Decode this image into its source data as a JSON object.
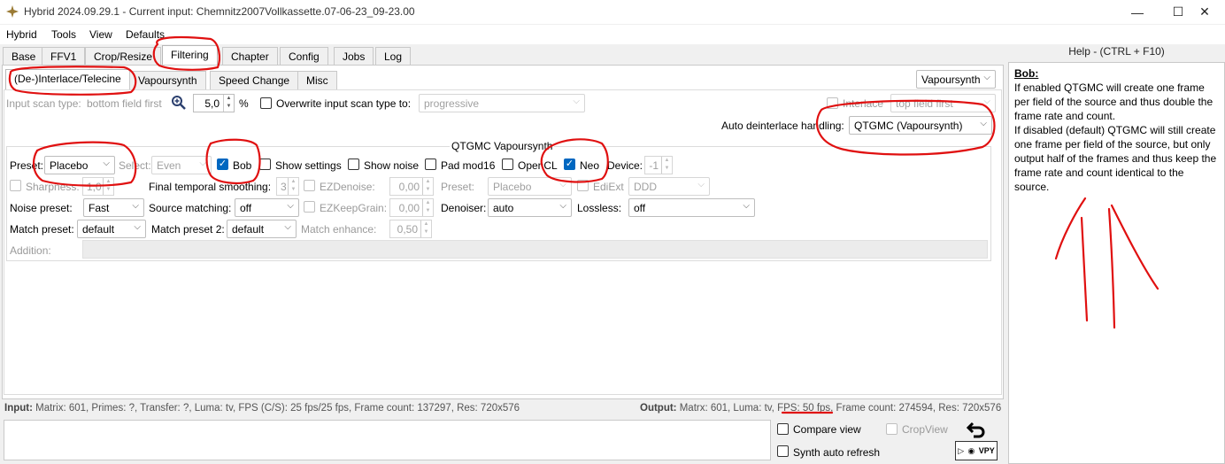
{
  "window": {
    "title": "Hybrid 2024.09.29.1 - Current input: Chemnitz2007Vollkassette.07-06-23_09-23.00",
    "minimize": "—",
    "maximize": "☐",
    "close": "✕"
  },
  "menu": [
    "Hybrid",
    "Tools",
    "View",
    "Defaults"
  ],
  "main_tabs": [
    "Base",
    "FFV1",
    "Crop/Resize",
    "Filtering",
    "Chapter",
    "Config",
    "Jobs",
    "Log"
  ],
  "sub_tabs": [
    "(De-)Interlace/Telecine",
    "Vapoursynth",
    "Speed Change",
    "Misc"
  ],
  "engine_select": "Vapoursynth",
  "scan": {
    "label": "Input scan type:",
    "value": "bottom field first",
    "zoom": "5,0",
    "unit": "%",
    "overwrite_label": "Overwrite input scan type to:",
    "overwrite_value": "progressive",
    "interlace_label": "Interlace",
    "interlace_value": "top field first"
  },
  "auto_deinterlace": {
    "label": "Auto deinterlace handling:",
    "value": "QTGMC (Vapoursynth)"
  },
  "qtgmc": {
    "title": "QTGMC Vapoursynth",
    "preset_label": "Preset:",
    "preset_value": "Placebo",
    "select_label": "Select:",
    "select_value": "Even",
    "bob_label": "Bob",
    "show_settings": "Show settings",
    "show_noise": "Show noise",
    "pad_mod16": "Pad mod16",
    "opencl": "OpenCL",
    "neo": "Neo",
    "device_label": "Device:",
    "device_value": "-1",
    "sharpness_label": "Sharpness:",
    "sharpness_value": "1,0",
    "fts_label": "Final temporal smoothing:",
    "fts_value": "3",
    "ezdenoise_label": "EZDenoise:",
    "ezdenoise_value": "0,00",
    "preset2_label": "Preset:",
    "preset2_value": "Placebo",
    "ediext_label": "EdiExt",
    "ediext_value": "DDD",
    "noise_preset_label": "Noise preset:",
    "noise_preset_value": "Fast",
    "source_matching_label": "Source matching:",
    "source_matching_value": "off",
    "ezkeepgrain_label": "EZKeepGrain:",
    "ezkeepgrain_value": "0,00",
    "denoiser_label": "Denoiser:",
    "denoiser_value": "auto",
    "lossless_label": "Lossless:",
    "lossless_value": "off",
    "match_preset_label": "Match preset:",
    "match_preset_value": "default",
    "match_preset2_label": "Match preset 2:",
    "match_preset2_value": "default",
    "match_enhance_label": "Match enhance:",
    "match_enhance_value": "0,50",
    "addition_label": "Addition:"
  },
  "status": {
    "input_label": "Input:",
    "input_text": "Matrix: 601, Primes: ?, Transfer: ?, Luma: tv, FPS (C/S): 25 fps/25 fps, Frame count: 137297, Res: 720x576",
    "output_label": "Output:",
    "output_text": "Matrx: 601, Luma: tv, FPS: 50 fps, Frame count: 274594, Res: 720x576"
  },
  "bottom": {
    "compare_view": "Compare view",
    "crop_view": "CropView",
    "synth_refresh": "Synth auto refresh",
    "vpy": "VPY"
  },
  "help": {
    "title": "Help - (CTRL + F10)",
    "heading": "Bob:",
    "p1": "If enabled QTGMC will create one frame per field of the source and thus double the frame rate and count.",
    "p2": "If disabled (default) QTGMC will still create one frame per field of the source, but only output half of the frames and thus keep the frame rate and count identical to the source."
  },
  "colors": {
    "accent": "#0067c0",
    "annotation": "#e01010"
  }
}
